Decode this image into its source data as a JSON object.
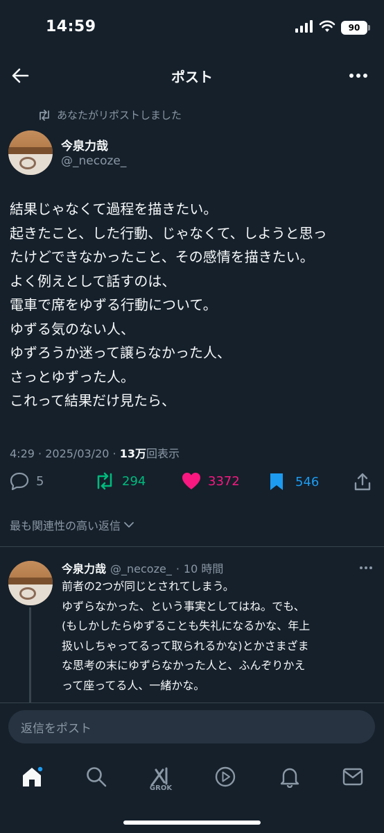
{
  "status_bar": {
    "time": "14:59",
    "battery": "90"
  },
  "header": {
    "title": "ポスト"
  },
  "repost_notice": "あなたがリポストしました",
  "post": {
    "author_name": "今泉力哉",
    "author_handle": "@_necoze_",
    "text_lines": [
      "結果じゃなくて過程を描きたい。",
      "起きたこと、した行動、じゃなくて、しようと思っ",
      "たけどできなかったこと、その感情を描きたい。",
      "よく例えとして話すのは、",
      "電車で席をゆずる行動について。",
      "ゆずる気のない人、",
      "ゆずろうか迷って譲らなかった人、",
      "さっとゆずった人。",
      "これって結果だけ見たら、"
    ],
    "time": "4:29",
    "date": "2025/03/20",
    "views_count": "13万",
    "views_label": "回表示"
  },
  "actions": {
    "reply_count": "5",
    "repost_count": "294",
    "like_count": "3372",
    "bookmark_count": "546"
  },
  "sort": {
    "label": "最も関連性の高い返信"
  },
  "reply": {
    "author_name": "今泉力哉",
    "author_handle": "@_necoze_",
    "time": "10 時間",
    "text_lines": [
      "前者の2つが同じとされてしまう。",
      "ゆずらなかった、という事実としてはね。でも、",
      "(もしかしたらゆずることも失礼になるかな、年上",
      "扱いしちゃってるって取られるかな)とかさまざま",
      "な思考の末にゆずらなかった人と、ふんぞりかえ",
      "って座ってる人、一緒かな。"
    ]
  },
  "compose": {
    "placeholder": "返信をポスト"
  },
  "nav": {
    "grok_label": "GROK"
  },
  "colors": {
    "background": "#15202b",
    "repost_green": "#00ba7c",
    "like_pink": "#f91880",
    "bookmark_blue": "#1d9bf0",
    "muted": "#8b98a5"
  }
}
